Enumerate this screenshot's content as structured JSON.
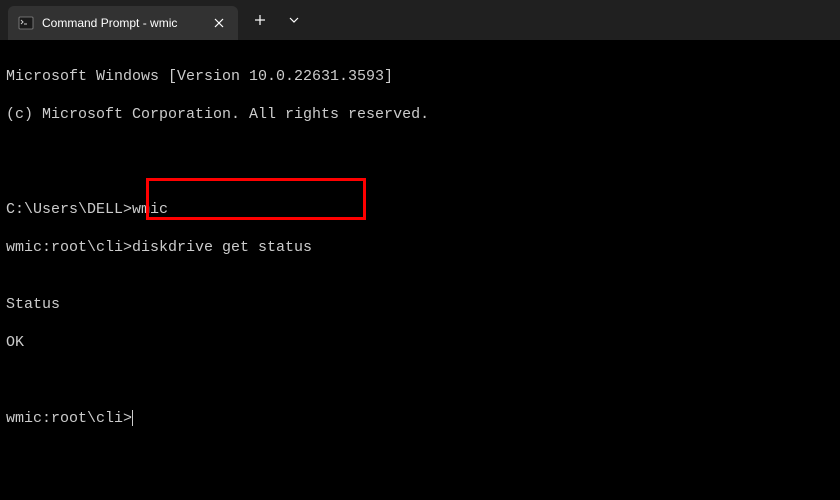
{
  "titlebar": {
    "tab_title": "Command Prompt - wmic",
    "close_label": "×",
    "new_tab_label": "+",
    "dropdown_label": "⌄"
  },
  "terminal": {
    "line1": "Microsoft Windows [Version 10.0.22631.3593]",
    "line2": "(c) Microsoft Corporation. All rights reserved.",
    "prompt1_prefix": "C:\\Users\\DELL>",
    "prompt1_cmd": "wmic",
    "prompt2_prefix": "wmic:root\\cli>",
    "prompt2_cmd": "diskdrive get status",
    "output_header": "Status",
    "output_value": "OK",
    "prompt3_prefix": "wmic:root\\cli>"
  },
  "colors": {
    "highlight": "#ff0000",
    "bg": "#000000",
    "fg": "#cccccc"
  }
}
